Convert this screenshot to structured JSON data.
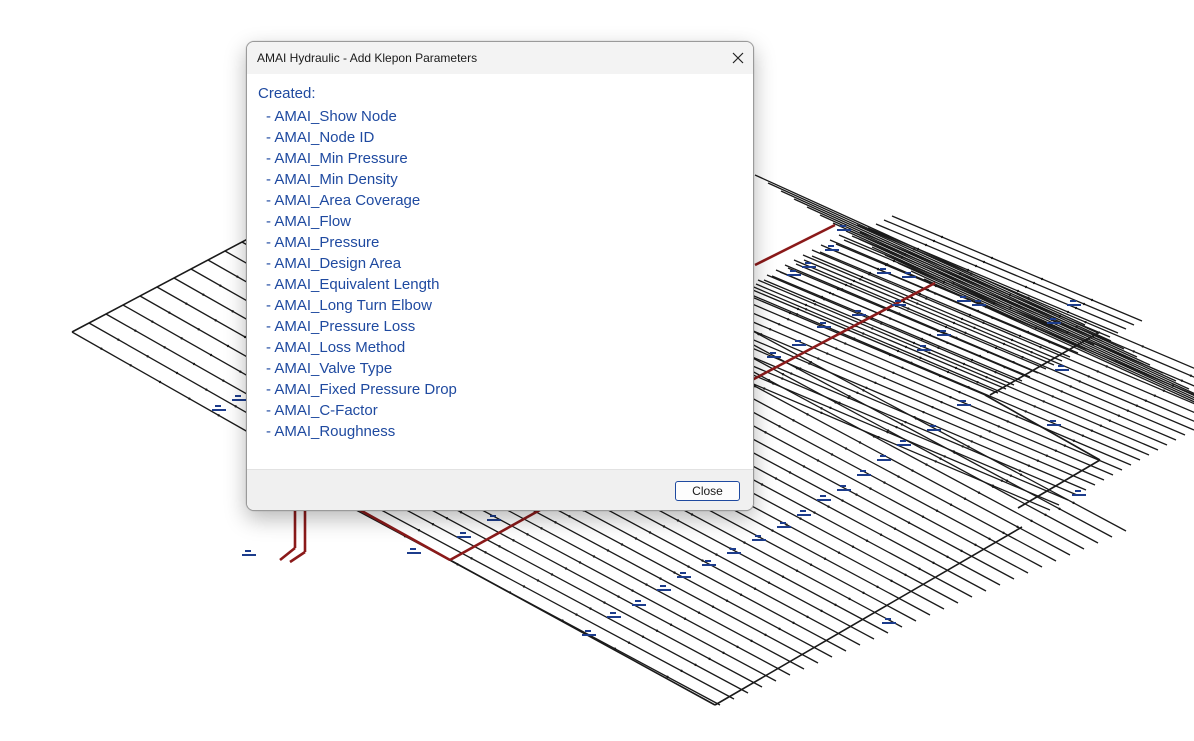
{
  "dialog": {
    "title": "AMAI Hydraulic - Add Klepon Parameters",
    "created_label": "Created:",
    "parameters": [
      "- AMAI_Show Node",
      "- AMAI_Node ID",
      "- AMAI_Min Pressure",
      "- AMAI_Min Density",
      "- AMAI_Area Coverage",
      "- AMAI_Flow",
      "- AMAI_Pressure",
      "- AMAI_Design Area",
      "- AMAI_Equivalent Length",
      "- AMAI_Long Turn Elbow",
      "- AMAI_Pressure Loss",
      "- AMAI_Loss Method",
      "- AMAI_Valve Type",
      "- AMAI_Fixed Pressure Drop",
      "- AMAI_C-Factor",
      "- AMAI_Roughness"
    ],
    "close_button_label": "Close",
    "close_icon": "close-icon"
  },
  "colors": {
    "parameter_text": "#1f4aa0",
    "pipe": "#1a1a1a",
    "riser_pipe": "#8b1a1a",
    "pipe_tag_text": "#1c3c8c"
  }
}
